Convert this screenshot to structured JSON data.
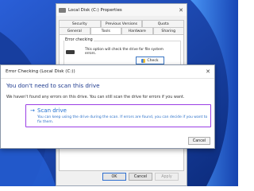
{
  "properties_window": {
    "title": "Local Disk (C:) Properties",
    "close_glyph": "✕",
    "tabs_row1": [
      "Security",
      "Previous Versions",
      "Quota"
    ],
    "tabs_row2": [
      "General",
      "Tools",
      "Hardware",
      "Sharing"
    ],
    "active_tab": "Tools",
    "error_checking": {
      "label": "Error checking",
      "text": "This option will check the drive for file system errors.",
      "button": "Check"
    },
    "buttons": {
      "ok": "OK",
      "cancel": "Cancel",
      "apply": "Apply"
    }
  },
  "dialog": {
    "title": "Error Checking (Local Disk (C:))",
    "close_glyph": "✕",
    "heading": "You don't need to scan this drive",
    "description": "We haven't found any errors on this drive. You can still scan the drive for errors if you want.",
    "scan_option": {
      "arrow": "→",
      "title": "Scan drive",
      "description": "You can keep using the drive during the scan. If errors are found, you can decide if you want to fix them."
    },
    "cancel_button": "Cancel"
  },
  "colors": {
    "desktop": "#1c3e9c",
    "heading": "#1f3b8f",
    "link": "#1f6fd0",
    "highlight": "#9b3fe5"
  }
}
